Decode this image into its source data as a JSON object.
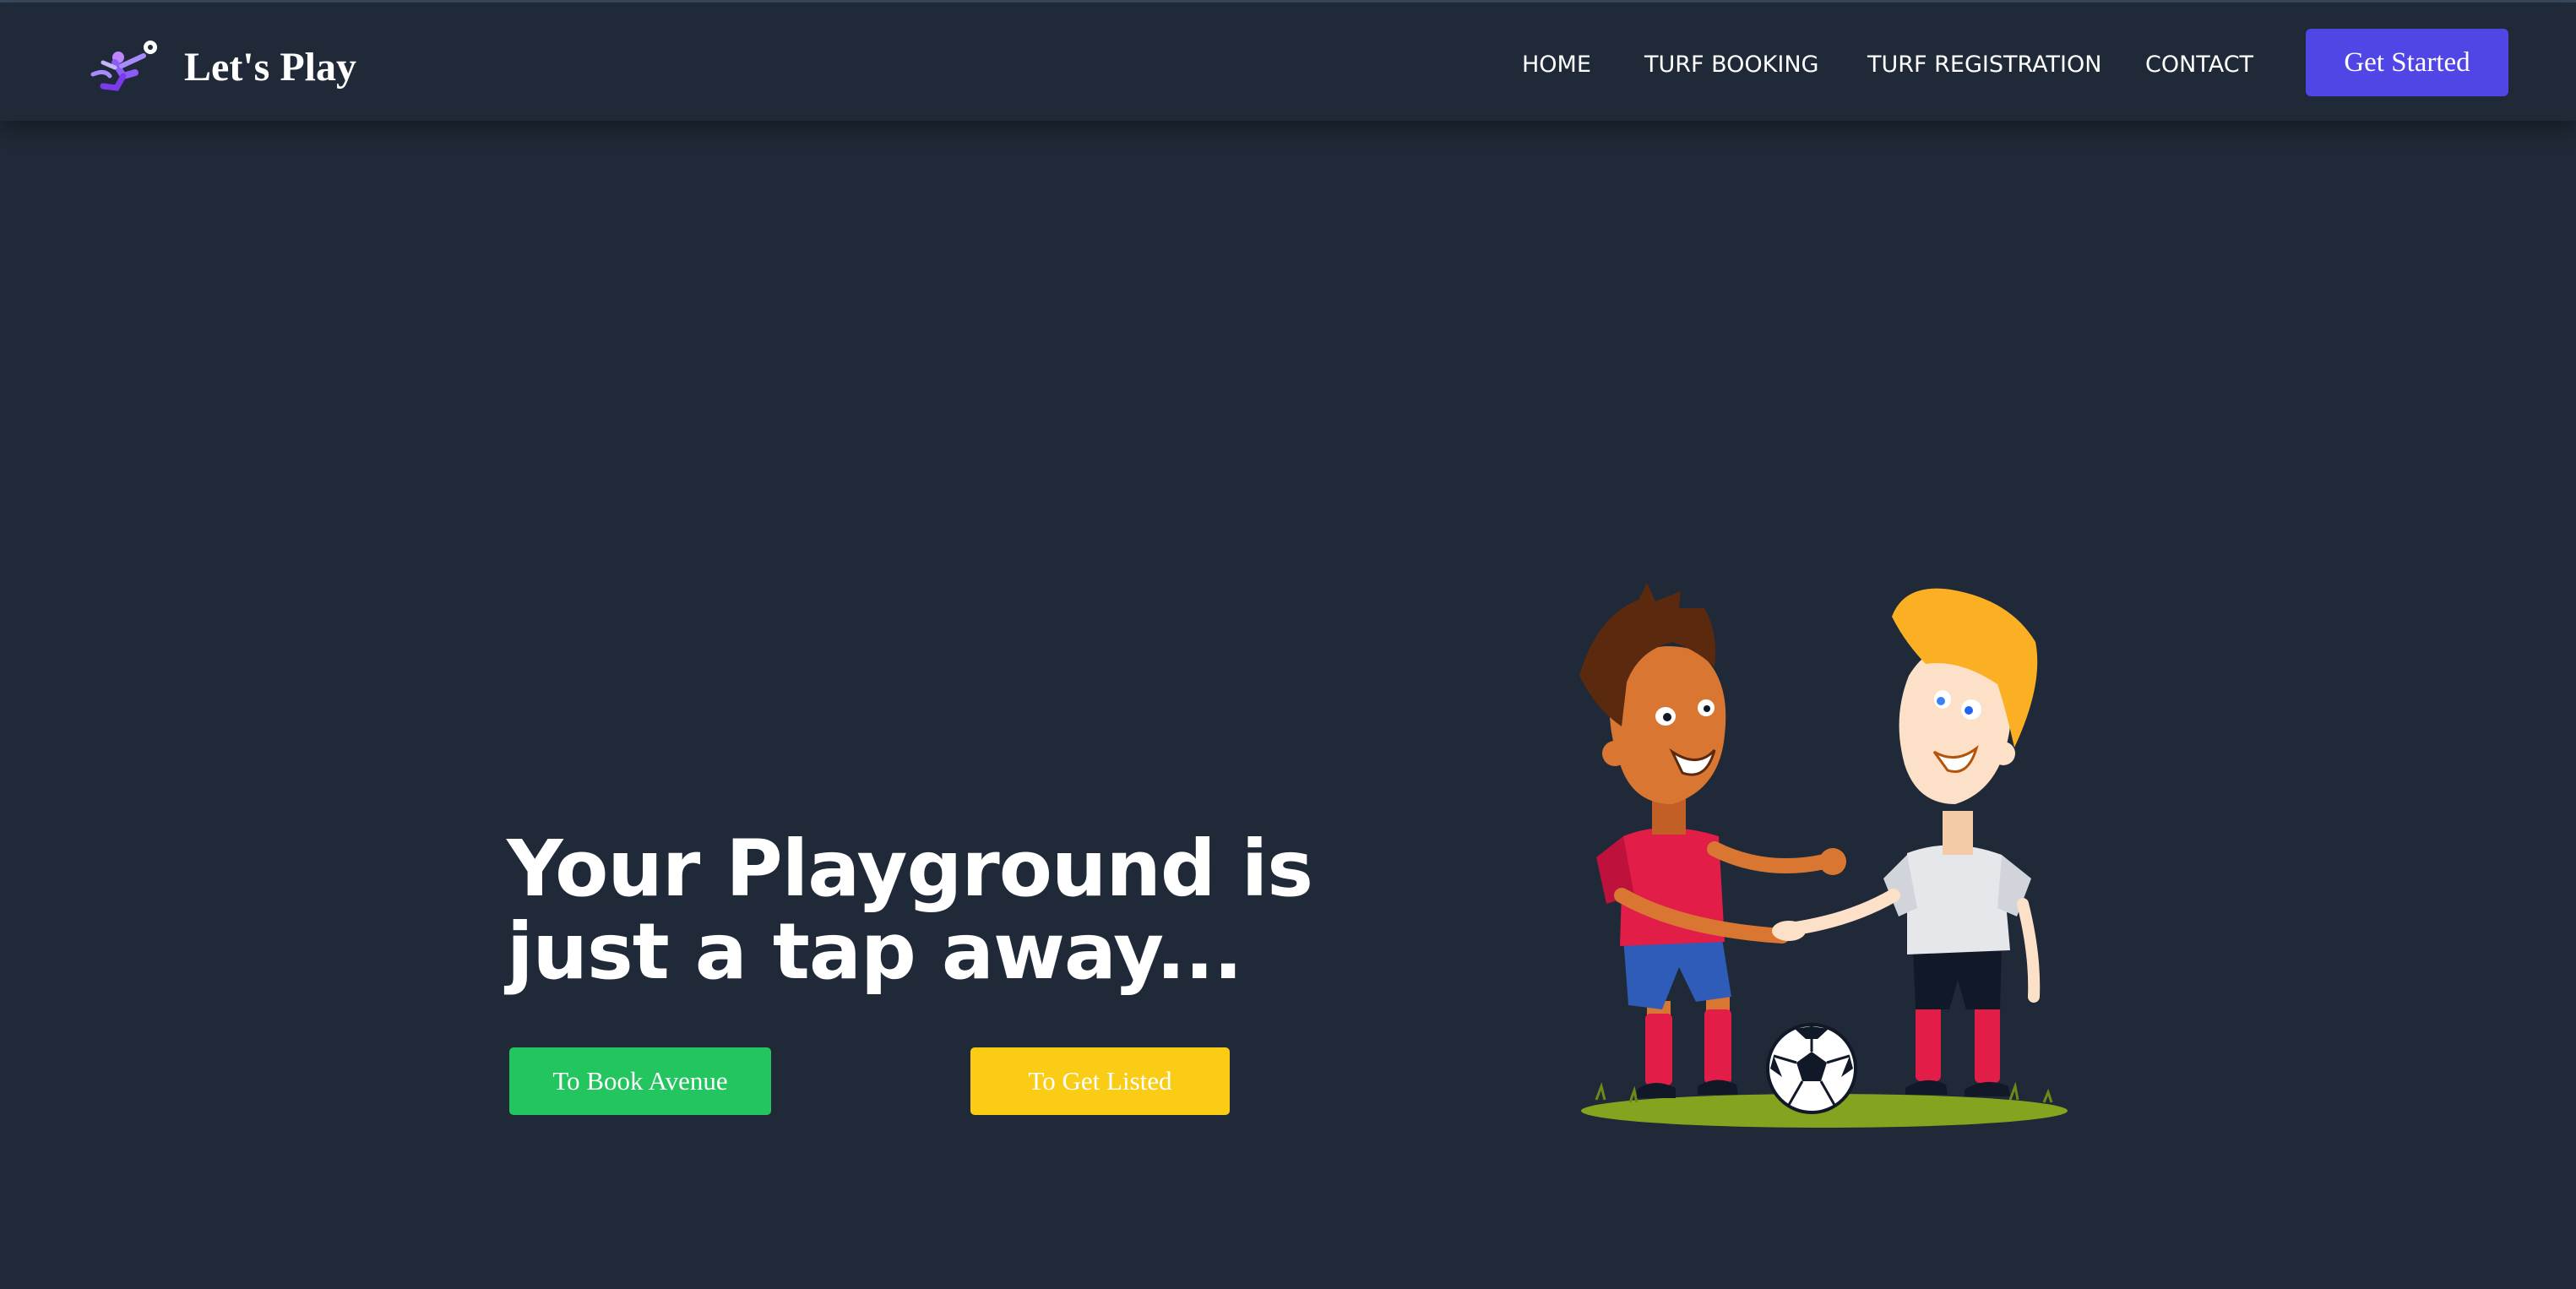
{
  "brand": {
    "name": "Let's Play",
    "logo_icon": "kicking-player-icon"
  },
  "nav": {
    "items": [
      {
        "label": "HOME"
      },
      {
        "label": "TURF BOOKING"
      },
      {
        "label": "TURF REGISTRATION"
      },
      {
        "label": "CONTACT"
      }
    ],
    "cta_label": "Get Started"
  },
  "hero": {
    "title_line1": "Your Playground is",
    "title_line2": "just a tap away...",
    "primary_button": "To Book Avenue",
    "secondary_button": "To Get Listed",
    "illustration_icon": "footballers-handshake-illustration"
  },
  "colors": {
    "background": "#1f2937",
    "cta": "#4f46e5",
    "green_button": "#22c55e",
    "yellow_button": "#facc15"
  }
}
